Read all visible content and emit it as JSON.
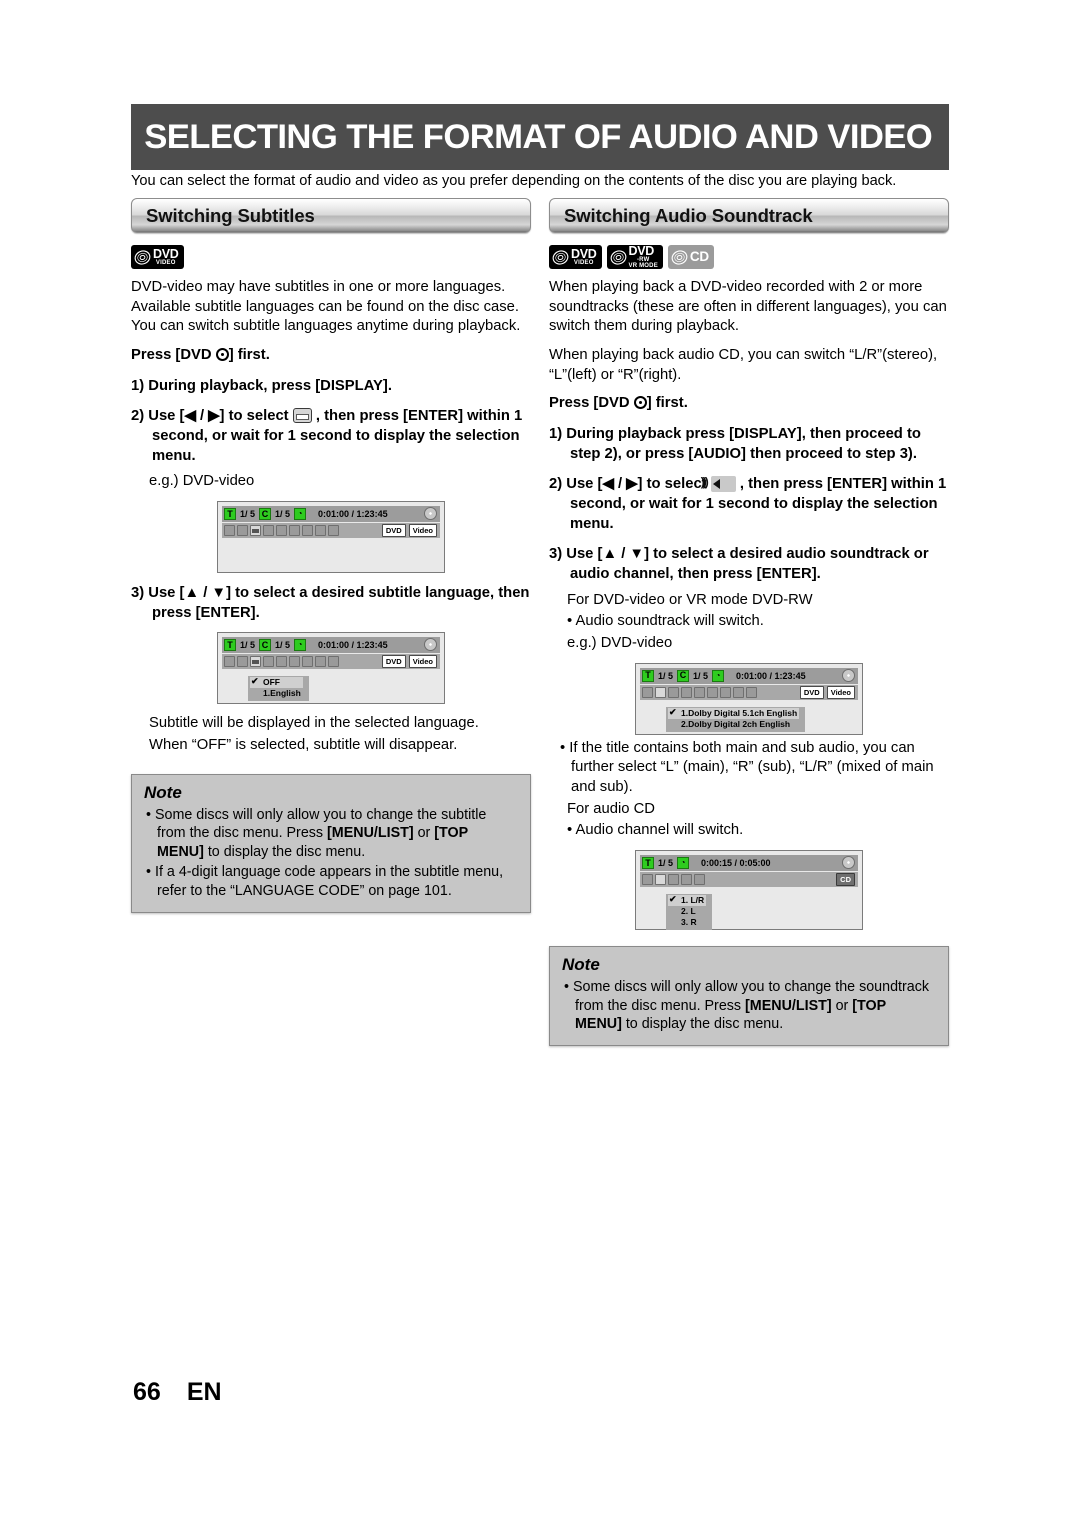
{
  "page": {
    "banner_title": "SELECTING THE FORMAT OF AUDIO AND VIDEO",
    "intro": "You can select the format of audio and video as you prefer depending on the contents of the disc you are playing back.",
    "page_number": "66",
    "page_lang": "EN"
  },
  "left": {
    "section_title": "Switching Subtitles",
    "logos": [
      {
        "name": "dvd-video",
        "line1": "DVD",
        "line2": "VIDEO",
        "line3": "",
        "style": "black"
      }
    ],
    "intro_paragraph": "DVD-video may have subtitles in one or more languages. Available subtitle languages can be found on the disc case. You can switch subtitle languages anytime during playback.",
    "press_first": "Press [DVD ◎] first.",
    "press_first_pre": "Press [DVD ",
    "press_first_post": "] first.",
    "step1": "1) During playback, press [DISPLAY].",
    "step2_pre": "2) Use [◀ / ▶] to select",
    "step2_post": ", then press [ENTER] within 1 second, or wait for 1 second to display the selection menu.",
    "eg_label": "e.g.) DVD-video",
    "step3": "3) Use [▲ / ▼] to select a desired subtitle language, then press [ENTER].",
    "after_text_1": "Subtitle will be displayed in the selected language.",
    "after_text_2": "When “OFF” is selected, subtitle will disappear.",
    "osd1": {
      "title_chip": "T",
      "title_num": "1/  5",
      "chapter_chip": "C",
      "chapter_num": "1/  5",
      "clock_chip": "◔",
      "time": "0:01:00 / 1:23:45",
      "tags": [
        "DVD",
        "Video"
      ]
    },
    "osd2": {
      "title_chip": "T",
      "title_num": "1/  5",
      "chapter_chip": "C",
      "chapter_num": "1/  5",
      "clock_chip": "◔",
      "time": "0:01:00 / 1:23:45",
      "tags": [
        "DVD",
        "Video"
      ],
      "menu": [
        "OFF",
        "1.English"
      ],
      "selected_index": 0
    },
    "note": {
      "heading": "Note",
      "items": [
        {
          "parts": [
            {
              "t": "Some discs will only allow you to change the subtitle from the disc menu. Press ",
              "b": false
            },
            {
              "t": "[MENU/LIST]",
              "b": true
            },
            {
              "t": " or ",
              "b": false
            },
            {
              "t": "[TOP MENU]",
              "b": true
            },
            {
              "t": " to display the disc menu.",
              "b": false
            }
          ]
        },
        {
          "parts": [
            {
              "t": "If a 4-digit language code appears in the subtitle menu, refer to the “LANGUAGE CODE” on page 101.",
              "b": false
            }
          ]
        }
      ]
    }
  },
  "right": {
    "section_title": "Switching Audio Soundtrack",
    "logos": [
      {
        "name": "dvd-video",
        "line1": "DVD",
        "line2": "VIDEO",
        "line3": "",
        "style": "black"
      },
      {
        "name": "dvd-rw-vr-mode",
        "line1": "DVD",
        "line2": "-RW",
        "line3": "VR MODE",
        "style": "black"
      },
      {
        "name": "cd",
        "line1": "CD",
        "line2": "",
        "line3": "",
        "style": "gray"
      }
    ],
    "intro_paragraph_1": "When playing back a DVD-video recorded with 2 or more soundtracks (these are often in different languages), you can switch them during playback.",
    "intro_paragraph_2": "When playing back audio CD, you can switch “L/R”(stereo), “L”(left) or “R”(right).",
    "press_first_pre": "Press [DVD ",
    "press_first_post": "] first.",
    "step1": "1) During playback press [DISPLAY], then proceed to step 2), or press [AUDIO] then proceed to step 3).",
    "step2_pre": "2) Use [◀ / ▶] to select",
    "step2_post": ", then press [ENTER] within 1 second, or wait for 1 second to display the selection menu.",
    "step3": "3) Use [▲ / ▼] to select a desired audio soundtrack or audio channel, then press [ENTER].",
    "for_dvd": "For DVD-video or VR mode DVD-RW",
    "bullet_soundtrack": "• Audio soundtrack will switch.",
    "eg_label": "e.g.) DVD-video",
    "bullet_mainsub": "• If the title contains both main and sub audio, you can further select “L” (main), “R” (sub), “L/R” (mixed of main and sub).",
    "for_cd": "For audio CD",
    "bullet_channel": "• Audio channel will switch.",
    "osd1": {
      "title_chip": "T",
      "title_num": "1/  5",
      "chapter_chip": "C",
      "chapter_num": "1/  5",
      "clock_chip": "◔",
      "time": "0:01:00 / 1:23:45",
      "tags": [
        "DVD",
        "Video"
      ],
      "menu": [
        "1.Dolby Digital  5.1ch English",
        "2.Dolby Digital    2ch English"
      ],
      "selected_index": 0
    },
    "osd2": {
      "title_chip": "T",
      "title_num": "1/  5",
      "clock_chip": "◔",
      "time": "0:00:15 / 0:05:00",
      "tags": [
        "CD"
      ],
      "menu": [
        "1. L/R",
        "2. L",
        "3. R"
      ],
      "selected_index": 0
    },
    "note": {
      "heading": "Note",
      "items": [
        {
          "parts": [
            {
              "t": "Some discs will only allow you to change the soundtrack from the disc menu. Press ",
              "b": false
            },
            {
              "t": "[MENU/LIST]",
              "b": true
            },
            {
              "t": " or ",
              "b": false
            },
            {
              "t": "[TOP MENU]",
              "b": true
            },
            {
              "t": " to display the disc menu.",
              "b": false
            }
          ]
        }
      ]
    }
  },
  "colors": {
    "banner_bg": "#4d4d4d",
    "note_bg": "#c6c6c6",
    "osd_chip_green": "#2ecc1f",
    "osd_bar_gray": "#9c9c9c"
  }
}
